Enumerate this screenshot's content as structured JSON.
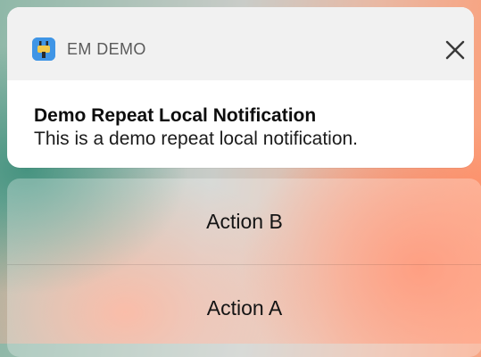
{
  "notification": {
    "app_name": "EM DEMO",
    "app_icon": "plug-icon",
    "close_icon": "close-icon",
    "title": "Demo Repeat Local Notification",
    "body": "This is a demo repeat local notification."
  },
  "actions": [
    {
      "label": "Action B"
    },
    {
      "label": "Action A"
    }
  ],
  "colors": {
    "card_background": "#ffffff",
    "header_background": "#f1f1f1",
    "app_icon_background": "#3f95e6",
    "text_primary": "#0d0d0d"
  }
}
